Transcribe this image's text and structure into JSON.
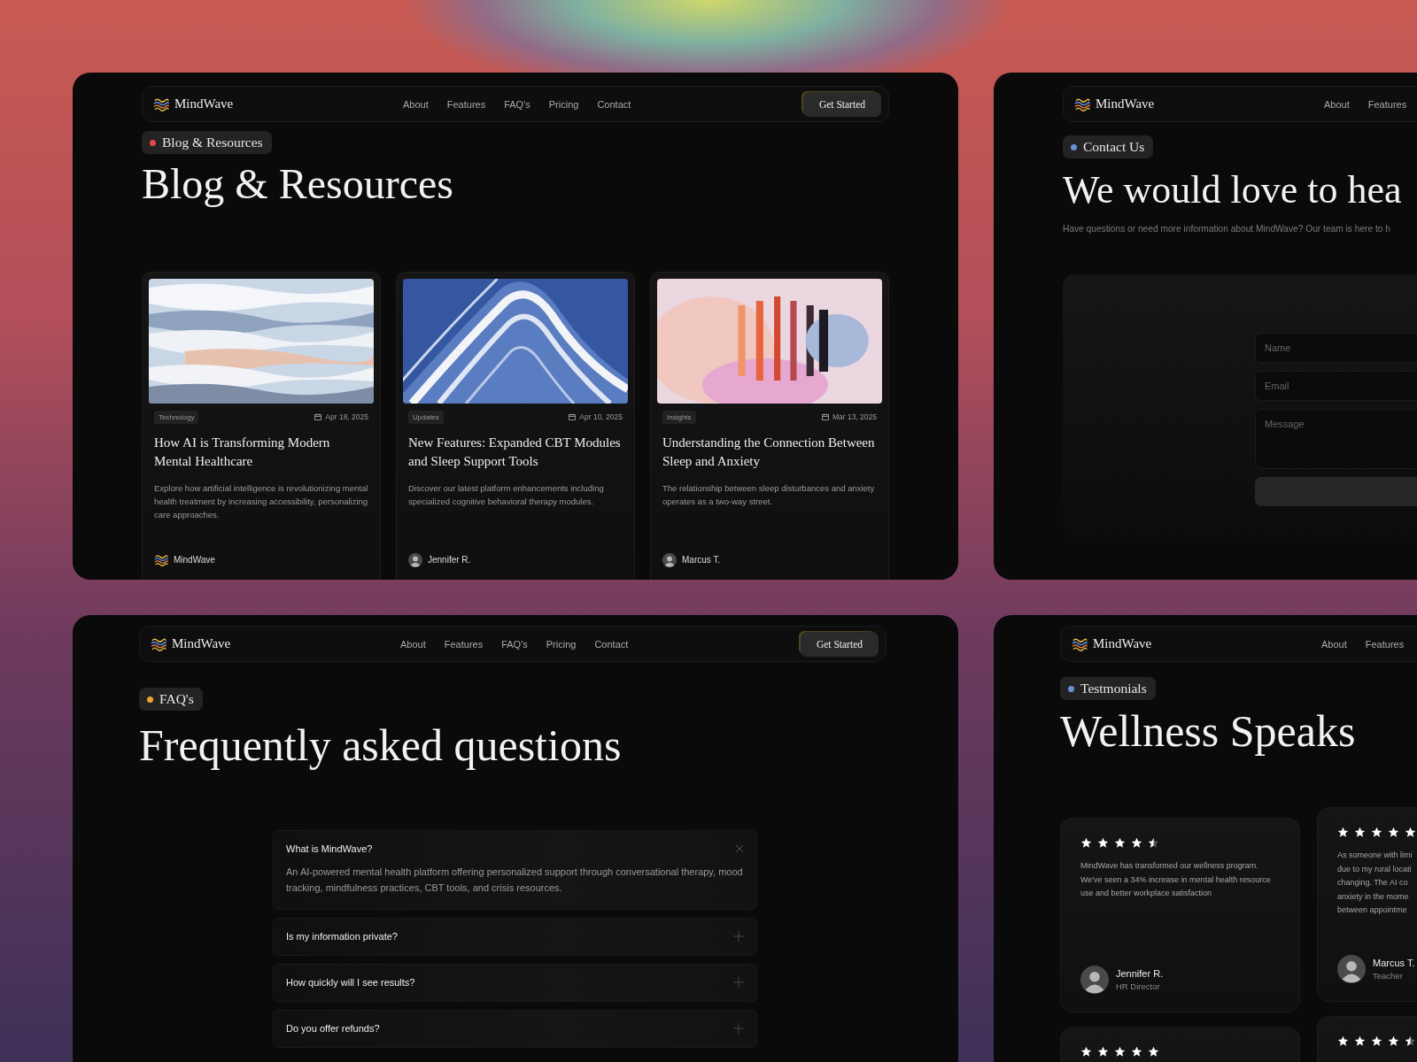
{
  "panels": [
    {
      "kind": "blog",
      "nav": {
        "brand": "MindWave",
        "links": [
          "About",
          "Features",
          "FAQ's",
          "Pricing",
          "Contact"
        ],
        "cta": "Get Started"
      },
      "badge": {
        "label": "Blog & Resources",
        "color": "#e5484d"
      },
      "heading": "Blog & Resources",
      "posts": [
        {
          "tag": "Technology",
          "date": "Apr 18, 2025",
          "title": "How AI is Transforming Modern Mental Healthcare",
          "excerpt": "Explore how artificial intelligence is revolutionizing mental health treatment by increasing accessibility, personalizing care approaches.",
          "author": "MindWave",
          "kind": "brand"
        },
        {
          "tag": "Updates",
          "date": "Apr 10, 2025",
          "title": "New Features: Expanded CBT Modules and Sleep Support Tools",
          "excerpt": "Discover our latest platform enhancements including specialized cognitive behavioral therapy modules.",
          "author": "Jennifer R.",
          "kind": "person"
        },
        {
          "tag": "Insights",
          "date": "Mar 13, 2025",
          "title": "Understanding the Connection Between Sleep and Anxiety",
          "excerpt": "The relationship between sleep disturbances and anxiety operates as a two-way street.",
          "author": "Marcus T.",
          "kind": "person"
        }
      ]
    },
    {
      "kind": "contact",
      "nav": {
        "brand": "MindWave",
        "links": [
          "About",
          "Features"
        ]
      },
      "badge": {
        "label": "Contact Us",
        "color": "#6b8fd6"
      },
      "heading": "We would love to hea",
      "subtitle": "Have questions or need more information about MindWave? Our team is here to h",
      "fields": [
        {
          "placeholder": "Name",
          "kind": "input"
        },
        {
          "placeholder": "Email",
          "kind": "input"
        },
        {
          "placeholder": "Message",
          "kind": "textarea"
        }
      ]
    },
    {
      "kind": "faq",
      "nav": {
        "brand": "MindWave",
        "links": [
          "About",
          "Features",
          "FAQ's",
          "Pricing",
          "Contact"
        ],
        "cta": "Get Started"
      },
      "badge": {
        "label": "FAQ's",
        "color": "#f0a030"
      },
      "heading": "Frequently asked questions",
      "items": [
        {
          "question": "What is MindWave?",
          "answer": "An AI-powered mental health platform offering personalized support through conversational therapy, mood tracking, mindfulness practices, CBT tools, and crisis resources.",
          "expanded": true
        },
        {
          "question": "Is my information private?",
          "expanded": false
        },
        {
          "question": "How quickly will I see results?",
          "expanded": false
        },
        {
          "question": "Do you offer refunds?",
          "expanded": false
        }
      ]
    },
    {
      "kind": "testimonials",
      "nav": {
        "brand": "MindWave",
        "links": [
          "About",
          "Features"
        ]
      },
      "badge": {
        "label": "Testmonials",
        "color": "#6b8fd6"
      },
      "heading": "Wellness Speaks",
      "cards": [
        {
          "stars": 4.5,
          "quote_lines": [
            "MindWave has transformed our wellness program.",
            "We've seen a 34% increase in mental health resource",
            "use and better workplace satisfaction"
          ],
          "name": "Jennifer R.",
          "role": "HR Director"
        },
        {
          "stars": 5,
          "quote_lines": [
            "As someone with limi",
            "due to my rural locati",
            "changing. The AI co",
            "anxiety in the mome",
            "between appointme"
          ],
          "name": "Marcus T.",
          "role": "Teacher"
        },
        {
          "stars": 5
        },
        {
          "stars": 4.5
        }
      ]
    }
  ]
}
